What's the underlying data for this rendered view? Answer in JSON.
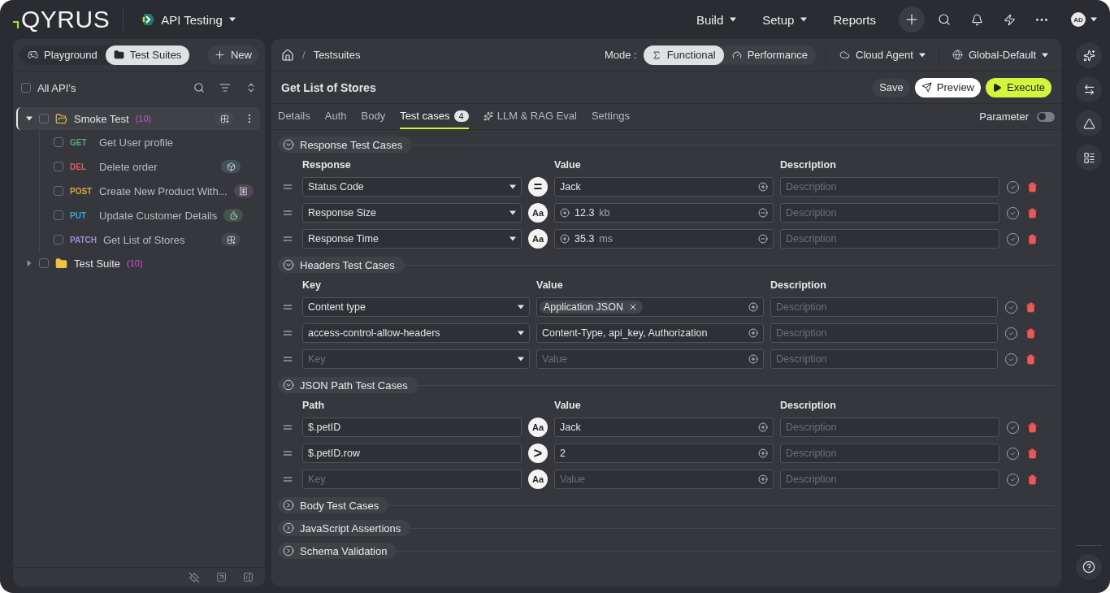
{
  "brand": {
    "logo": "QYRUS"
  },
  "app_switcher": {
    "label": "API Testing"
  },
  "nav": [
    {
      "label": "Build",
      "dropdown": true
    },
    {
      "label": "Setup",
      "dropdown": true
    },
    {
      "label": "Reports",
      "dropdown": false
    }
  ],
  "user": {
    "initials": "AD"
  },
  "sidebar": {
    "tabs": [
      {
        "label": "Playground",
        "kind": "playground",
        "selected": false
      },
      {
        "label": "Test Suites",
        "kind": "suites",
        "selected": true
      }
    ],
    "new_button": "New",
    "all_label": "All API’s",
    "all_checked": false,
    "tree": [
      {
        "label": "Smoke Test",
        "count": "(10)",
        "expanded": true,
        "selected": true,
        "checked": false,
        "kind": "grid",
        "children": [
          {
            "method": "GET",
            "color": "#4fb06d",
            "name": "Get User profile",
            "checked": false
          },
          {
            "method": "DEL",
            "color": "#e05a5a",
            "name": "Delete order",
            "checked": false,
            "kind": "cube"
          },
          {
            "method": "POST",
            "color": "#d9a53a",
            "name": "Create New Product With...",
            "checked": false,
            "kind": "card"
          },
          {
            "method": "PUT",
            "color": "#3aa6cf",
            "name": "Update Customer Details",
            "checked": false,
            "kind": "timer"
          },
          {
            "method": "PATCH",
            "color": "#a48ad6",
            "name": "Get List of Stores",
            "checked": false,
            "kind": "grid"
          }
        ]
      },
      {
        "label": "Test Suite",
        "count": "(10)",
        "expanded": false,
        "selected": false,
        "checked": false
      }
    ]
  },
  "breadcrumb": {
    "separator": "/",
    "items": [
      "Testsuites"
    ]
  },
  "mode": {
    "label": "Mode :",
    "options": [
      {
        "label": "Functional",
        "kind": "functional",
        "selected": true
      },
      {
        "label": "Performance",
        "kind": "performance",
        "selected": false
      }
    ]
  },
  "agent": "Cloud Agent",
  "environment": "Global-Default",
  "request": {
    "title": "Get List of Stores"
  },
  "actions": [
    {
      "label": "Save",
      "kind": "plain"
    },
    {
      "label": "Preview",
      "kind": "preview"
    },
    {
      "label": "Execute",
      "kind": "execute"
    }
  ],
  "tabs": [
    {
      "label": "Details",
      "selected": false
    },
    {
      "label": "Auth",
      "selected": false
    },
    {
      "label": "Body",
      "selected": false
    },
    {
      "label": "Test cases",
      "badge": "4",
      "selected": true
    },
    {
      "label": "LLM & RAG Eval",
      "kind": "ai",
      "selected": false
    },
    {
      "label": "Settings",
      "selected": false
    }
  ],
  "parameter": {
    "label": "Parameter",
    "on": false
  },
  "sections": [
    {
      "title": "Response Test Cases",
      "kind": "response",
      "expanded": true,
      "columns": [
        "Response",
        "Value",
        "Description"
      ],
      "rows": [
        {
          "key": {
            "text": "Status Code"
          },
          "operator": "=",
          "value": {
            "kind": "text",
            "text": "Jack"
          },
          "description": {
            "placeholder": "Description"
          }
        },
        {
          "key": {
            "text": "Response Size"
          },
          "operator": "Aa",
          "value": {
            "kind": "stepper",
            "text": "12.3",
            "unit": "kb"
          },
          "description": {
            "placeholder": "Description"
          }
        },
        {
          "key": {
            "text": "Response Time"
          },
          "operator": "Aa",
          "value": {
            "kind": "stepper",
            "text": "35.3",
            "unit": "ms"
          },
          "description": {
            "placeholder": "Description"
          }
        }
      ]
    },
    {
      "title": "Headers Test Cases",
      "kind": "headers",
      "expanded": true,
      "columns": [
        "Key",
        "Value",
        "Description"
      ],
      "rows": [
        {
          "key": {
            "text": "Content type"
          },
          "value": {
            "kind": "tag",
            "text": "Application JSON"
          },
          "description": {
            "placeholder": "Description"
          }
        },
        {
          "key": {
            "text": "access-control-allow-headers"
          },
          "value": {
            "kind": "text",
            "text": "Content-Type, api_key, Authorization"
          },
          "description": {
            "placeholder": "Description"
          }
        },
        {
          "key": {
            "placeholder": "Key"
          },
          "value": {
            "kind": "text",
            "placeholder": "Value"
          },
          "description": {
            "placeholder": "Description"
          }
        }
      ]
    },
    {
      "title": "JSON Path Test Cases",
      "kind": "json_path",
      "expanded": true,
      "columns": [
        "Path",
        "Value",
        "Description"
      ],
      "rows": [
        {
          "key": {
            "text": "$.petID"
          },
          "operator": "Aa",
          "value": {
            "kind": "text",
            "text": "Jack"
          },
          "description": {
            "placeholder": "Description"
          }
        },
        {
          "key": {
            "text": "$.petID.row"
          },
          "operator": ">",
          "value": {
            "kind": "text",
            "text": "2"
          },
          "description": {
            "placeholder": "Description"
          }
        },
        {
          "key": {
            "placeholder": "Key"
          },
          "operator": "Aa",
          "value": {
            "kind": "text",
            "placeholder": "Value"
          },
          "description": {
            "placeholder": "Description"
          }
        }
      ]
    },
    {
      "title": "Body Test Cases",
      "kind": "body",
      "expanded": false
    },
    {
      "title": "JavaScript Assertions",
      "kind": "script",
      "expanded": false
    },
    {
      "title": "Schema Validation",
      "kind": "schema",
      "expanded": false
    }
  ]
}
